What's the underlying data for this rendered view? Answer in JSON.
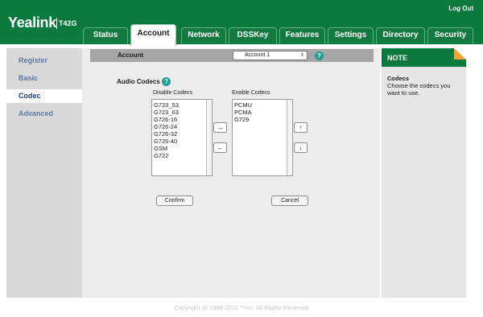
{
  "header": {
    "brand": "Yealink",
    "model": "T42G",
    "logout": "Log Out"
  },
  "tabs": [
    {
      "label": "Status"
    },
    {
      "label": "Account",
      "active": true
    },
    {
      "label": "Network"
    },
    {
      "label": "DSSKey"
    },
    {
      "label": "Features"
    },
    {
      "label": "Settings"
    },
    {
      "label": "Directory"
    },
    {
      "label": "Security"
    }
  ],
  "sidebar": {
    "items": [
      {
        "label": "Register"
      },
      {
        "label": "Basic"
      },
      {
        "label": "Codec",
        "active": true
      },
      {
        "label": "Advanced"
      }
    ]
  },
  "account": {
    "label": "Account",
    "selected": "Account 1"
  },
  "codecs": {
    "title": "Audio Codecs",
    "disable_label": "Disable Codecs",
    "enable_label": "Enable Codecs",
    "disabled": [
      "G723_53",
      "G723_63",
      "G726-16",
      "G726-24",
      "G726-32",
      "G726-40",
      "GSM",
      "G722"
    ],
    "enabled": [
      "PCMU",
      "PCMA",
      "G729"
    ],
    "move_right": "→",
    "move_left": "←",
    "move_up": "↑",
    "move_down": "↓",
    "confirm": "Confirm",
    "cancel": "Cancel"
  },
  "note": {
    "title": "NOTE",
    "heading": "Codecs",
    "text": "Choose the codecs you want to use."
  },
  "footer": "Copyright @ 1998-2012 **Inc. All Rights Reserved",
  "colors": {
    "brand_green": "#0c7a3c",
    "help_teal": "#1e9f94",
    "note_accent": "#f2a33a",
    "nav_link": "#5a7aa8"
  }
}
